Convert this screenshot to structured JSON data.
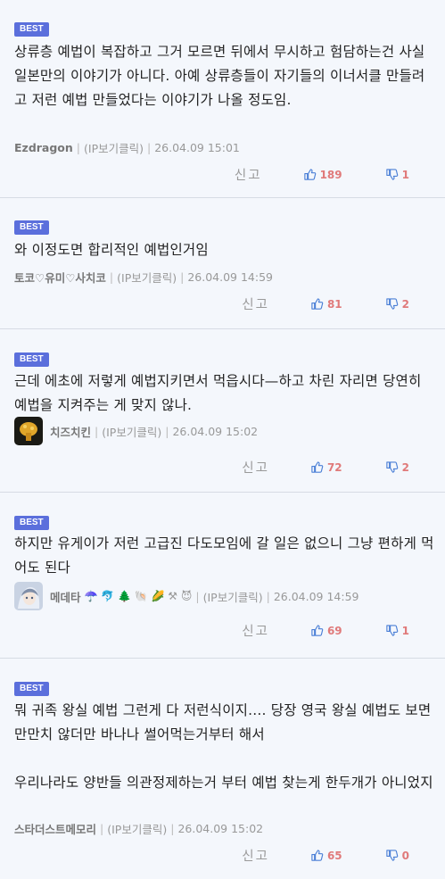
{
  "comments": [
    {
      "badge": "BEST",
      "text": "상류층 예법이 복잡하고 그거 모르면 뒤에서 무시하고 험담하는건 사실 일본만의 이야기가 아니다. 아예 상류층들이 자기들의 이너서클 만들려고 저런 예법 만들었다는 이야기가 나올 정도임.",
      "nick": "Ezdragon",
      "ip": "(IP보기클릭)",
      "date": "26.04.09 15:01",
      "reply": "신고",
      "likes": "189",
      "dislikes": "1"
    },
    {
      "badge": "BEST",
      "text": "와 이정도면 합리적인 예법인거임",
      "nick": "토코♡유미♡사치코",
      "ip": "(IP보기클릭)",
      "date": "26.04.09 14:59",
      "reply": "신고",
      "likes": "81",
      "dislikes": "2"
    },
    {
      "badge": "BEST",
      "text": "근데 에초에 저렇게 예법지키면서 먹읍시다—하고 차린 자리면 당연히 예법을 지켜주는 게 맞지 않나.",
      "nick": "치즈치킨",
      "ip": "(IP보기클릭)",
      "date": "26.04.09 15:02",
      "reply": "신고",
      "likes": "72",
      "dislikes": "2"
    },
    {
      "badge": "BEST",
      "text": "하지만 유게이가 저런 고급진 다도모임에 갈 일은 없으니 그냥 편하게 먹어도 된다",
      "nick": "메데타",
      "nick_emojis": "☂️ 🐬 🌲 🐚 🌽 ⚒ 😈",
      "ip": "(IP보기클릭)",
      "date": "26.04.09 14:59",
      "reply": "신고",
      "likes": "69",
      "dislikes": "1"
    },
    {
      "badge": "BEST",
      "text": "뭐 귀족 왕실 예법 그런게 다 저런식이지.... 당장 영국 왕실 예법도 보면 만만치 않더만 바나나 썰어먹는거부터 해서\n\n우리나라도 양반들 의관정제하는거 부터 예법 찾는게 한두개가 아니었지",
      "nick": "스타더스트메모리",
      "ip": "(IP보기클릭)",
      "date": "26.04.09 15:02",
      "reply": "신고",
      "likes": "65",
      "dislikes": "0"
    }
  ],
  "colors": {
    "badge": "#5b6fdc",
    "like_icon": "#4a7fd6",
    "dislike_icon": "#4a7fd6",
    "count": "#e07a7a",
    "background": "#f4f7fc"
  }
}
